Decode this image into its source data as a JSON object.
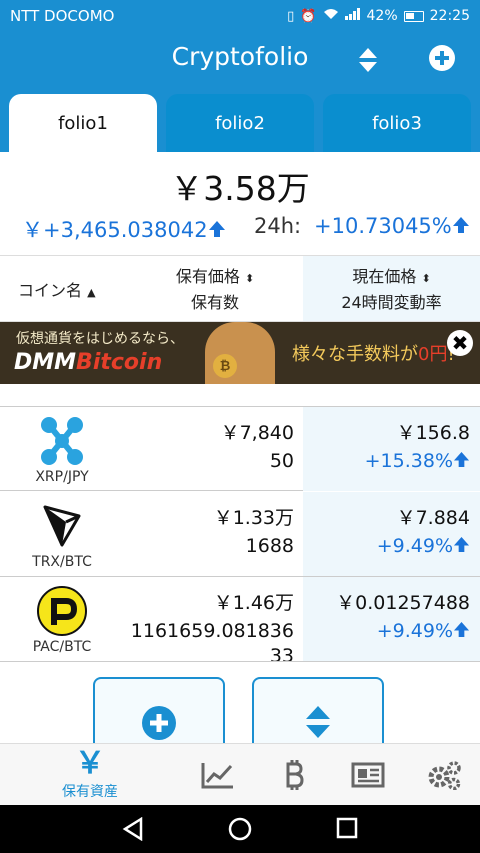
{
  "status": {
    "carrier": "NTT DOCOMO",
    "battery": "42%",
    "time": "22:25"
  },
  "app": {
    "title": "Cryptofolio"
  },
  "tabs": [
    {
      "label": "folio1",
      "active": true
    },
    {
      "label": "folio2",
      "active": false
    },
    {
      "label": "folio3",
      "active": false
    }
  ],
  "summary": {
    "total": "￥3.58万",
    "gain": "￥+3,465.038042",
    "h24_label": "24h:",
    "h24_value": "+10.73045%"
  },
  "columns": {
    "coin": "コイン名",
    "holding_line1": "保有価格",
    "holding_line2": "保有数",
    "price_line1": "現在価格",
    "price_line2": "24時間変動率"
  },
  "ad": {
    "line1": "仮想通貨をはじめるなら、",
    "brand_a": "DMM",
    "brand_b": "Bitcoin",
    "promo_a": "様々な手数料が",
    "promo_b": "0円",
    "promo_c": "!",
    "close": "✖"
  },
  "coins": [
    {
      "pair": "XRP/JPY",
      "value": "￥7,840",
      "amount": "50",
      "price": "￥156.8",
      "change": "+15.38%"
    },
    {
      "pair": "TRX/BTC",
      "value": "￥1.33万",
      "amount": "1688",
      "price": "￥7.884",
      "change": "+9.49%"
    },
    {
      "pair": "PAC/BTC",
      "value": "￥1.46万",
      "amount": "1161659.081836",
      "amount2": "33",
      "price": "￥0.01257488",
      "change": "+9.49%"
    }
  ],
  "bottom_nav": {
    "assets_label": "保有資産",
    "assets_icon": "￥"
  },
  "colors": {
    "primary": "#1a8fd1",
    "positive": "#1a73d9",
    "highlight": "#eef7fc"
  }
}
